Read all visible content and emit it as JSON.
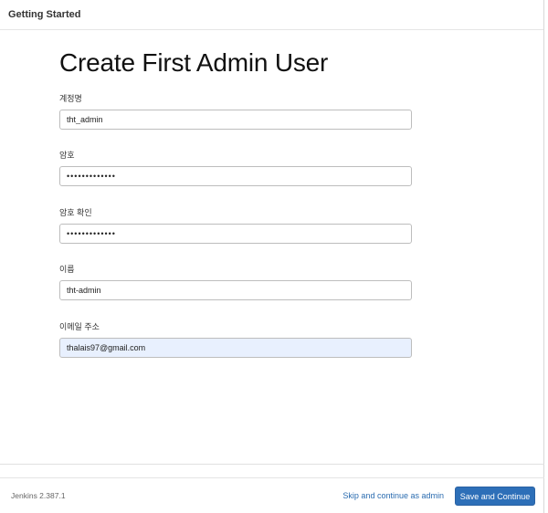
{
  "header": {
    "title": "Getting Started"
  },
  "main": {
    "title": "Create First Admin User",
    "fields": [
      {
        "label": "계정명",
        "value": "tht_admin",
        "type": "text"
      },
      {
        "label": "암호",
        "value": "•••••••••••••",
        "type": "password"
      },
      {
        "label": "암호 확인",
        "value": "•••••••••••••",
        "type": "password"
      },
      {
        "label": "이름",
        "value": "tht-admin",
        "type": "text"
      },
      {
        "label": "이메일 주소",
        "value": "thalais97@gmail.com",
        "type": "email"
      }
    ]
  },
  "footer": {
    "version": "Jenkins 2.387.1",
    "skip_label": "Skip and continue as admin",
    "save_label": "Save and Continue"
  },
  "colors": {
    "primary_button": "#2d6fb8",
    "link": "#2b6cb0",
    "autofill_bg": "#e8f0fe"
  }
}
